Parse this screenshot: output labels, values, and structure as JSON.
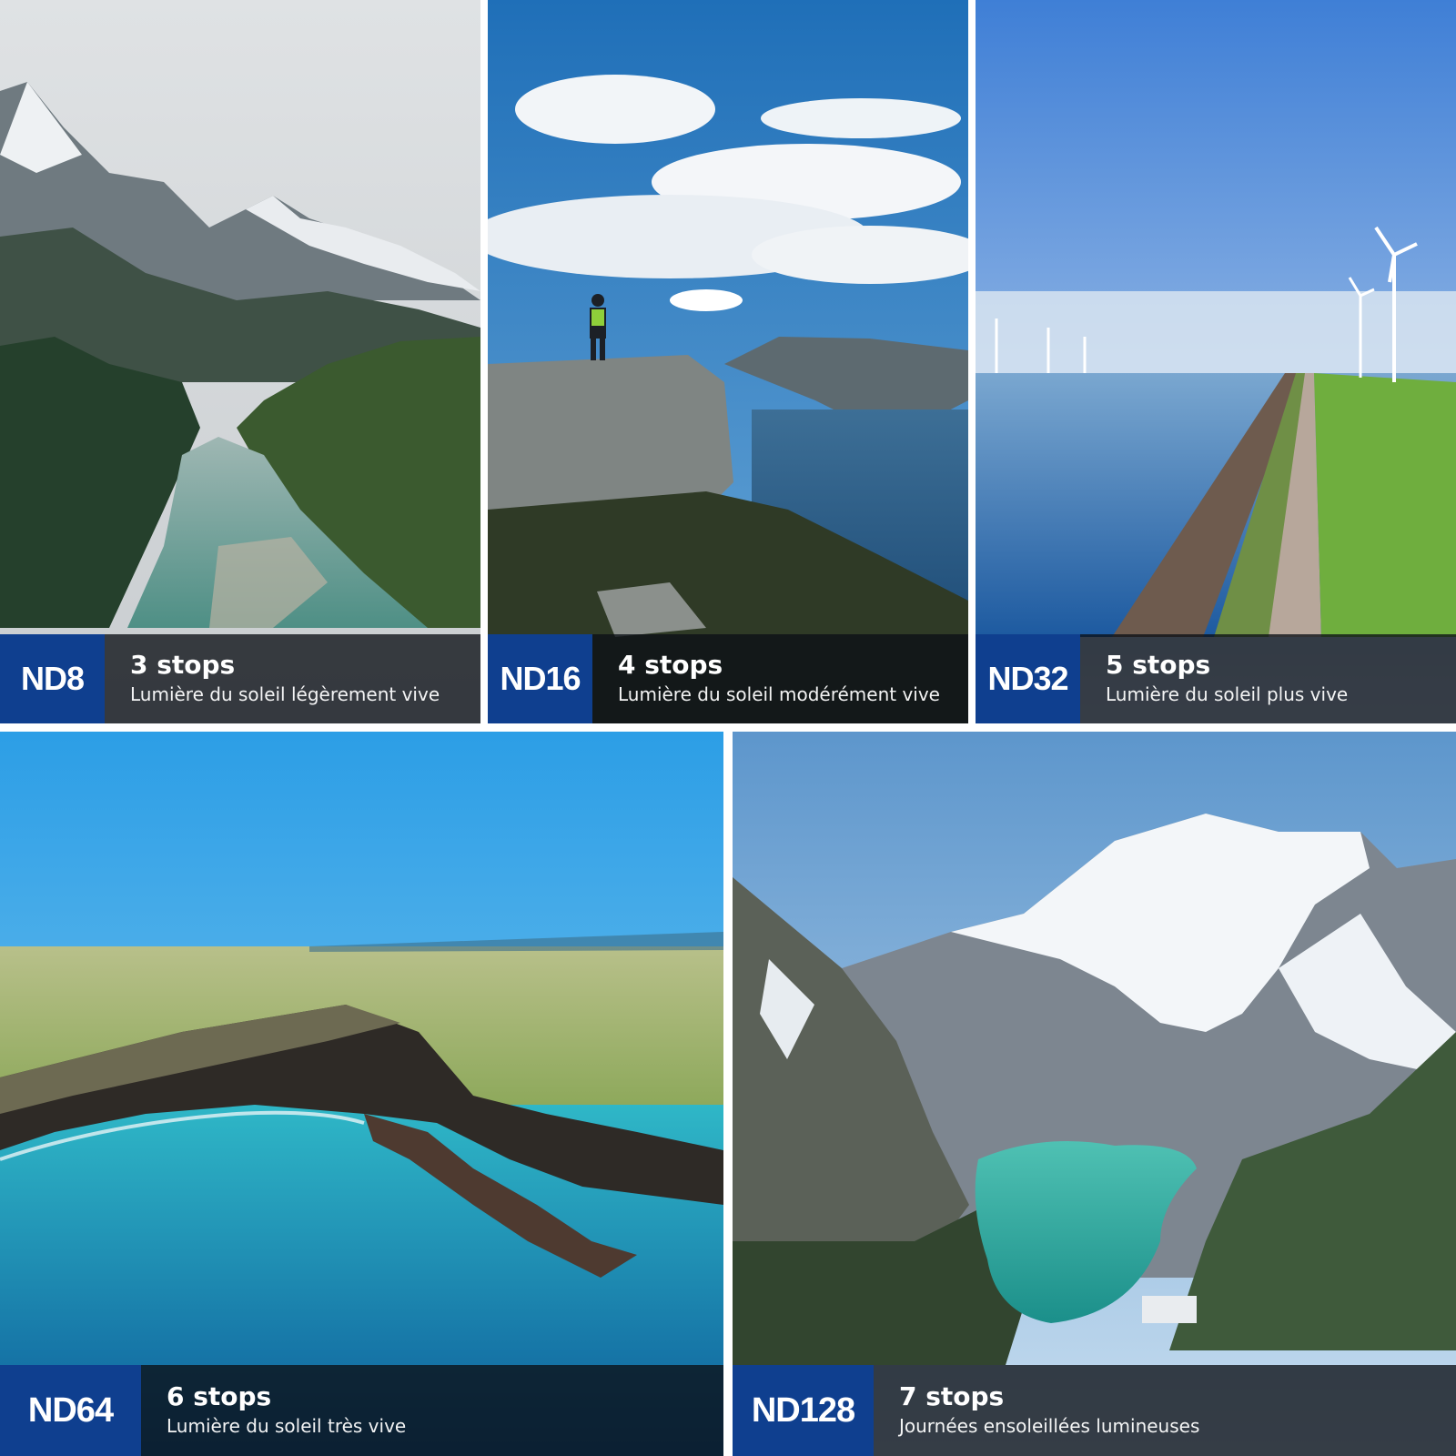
{
  "filters": [
    {
      "badge": "ND8",
      "stops": "3 stops",
      "description": "Lumière du soleil légèrement vive",
      "scene": "mountain-river-forest"
    },
    {
      "badge": "ND16",
      "stops": "4 stops",
      "description": "Lumière du soleil modérément vive",
      "scene": "hiker-on-cliff-fjord"
    },
    {
      "badge": "ND32",
      "stops": "5 stops",
      "description": "Lumière du soleil plus vive",
      "scene": "sea-dike-wind-turbines"
    },
    {
      "badge": "ND64",
      "stops": "6 stops",
      "description": "Lumière du soleil très vive",
      "scene": "coastal-bay-turquoise-water"
    },
    {
      "badge": "ND128",
      "stops": "7 stops",
      "description": "Journées ensoleillées lumineuses",
      "scene": "snowy-peaks-alpine-lake"
    }
  ],
  "colors": {
    "badge_blue": "#0f3f8f",
    "caption_overlay": "rgba(12,16,22,0.78)"
  }
}
